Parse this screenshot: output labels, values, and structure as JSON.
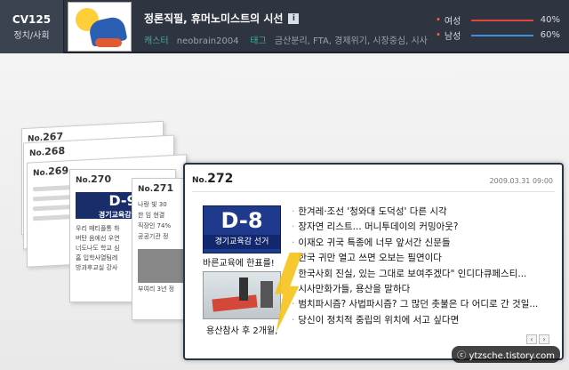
{
  "header": {
    "channel": "CV125",
    "category": "정치/사회",
    "title": "정론직필, 휴머노미스트의 시선",
    "owner_label": "캐스터",
    "owner": "neobrain2004",
    "tags_label": "태그",
    "tags": "금산분리, FTA, 경제위기, 시장중심, 시사",
    "gender": [
      {
        "label": "여성",
        "pct": "40%",
        "color": "#e2433a"
      },
      {
        "label": "남성",
        "pct": "60%",
        "color": "#3b8edb"
      }
    ]
  },
  "cards": {
    "c267": {
      "pre": "No.",
      "num": "267"
    },
    "c268": {
      "pre": "No.",
      "num": "268"
    },
    "c269": {
      "pre": "No.",
      "num": "269"
    },
    "c270": {
      "pre": "No.",
      "num": "270"
    },
    "c271": {
      "pre": "No.",
      "num": "271"
    },
    "c270_lines": [
      "우리 매티플통 하",
      "버탄 음에선 우연",
      "너도나도 학교 심",
      "홈 입학사열팀레",
      "방과후교실 강사"
    ],
    "c271_lines": [
      "나랑 빛 30",
      "한 임 현결",
      "직장인 74%",
      "공공기관 정"
    ],
    "c271_caption": "부여리 3년 정",
    "d9": "D-9",
    "d9_sub": "경기교육감 선거"
  },
  "main": {
    "no_prefix": "No.",
    "no": "272",
    "date": "2009.03.31 09:00",
    "d8": "D-8",
    "d8_sub": "경기교육감 선거",
    "d8_caption": "바른교육에 한표를!",
    "photo_caption": "용산참사 후 2개월,",
    "headlines": [
      "한겨레·조선 '청와대 도덕성' 다른 시각",
      "장자연 리스트... 머니투데이의 커밍아웃?",
      "이재오 귀국 특종에 너무 앞서간 신문들",
      "한국 귀만 열고 쓰면 오보는 필연이다",
      "한국사회 진실, 있는 그대로 보여주겠다\" 인디다큐페스티...",
      "시사만화가들, 용산을 말하다",
      "범치파시즘? 사법파시즘? 그 많던 촛불은 다 어디로 간 것일...",
      "당신이 정치적 중립의 위치에 서고 싶다면"
    ],
    "pager_prev": "‹",
    "pager_next": "›"
  },
  "watermark": "ⓒ ytzsche.tistory.com"
}
